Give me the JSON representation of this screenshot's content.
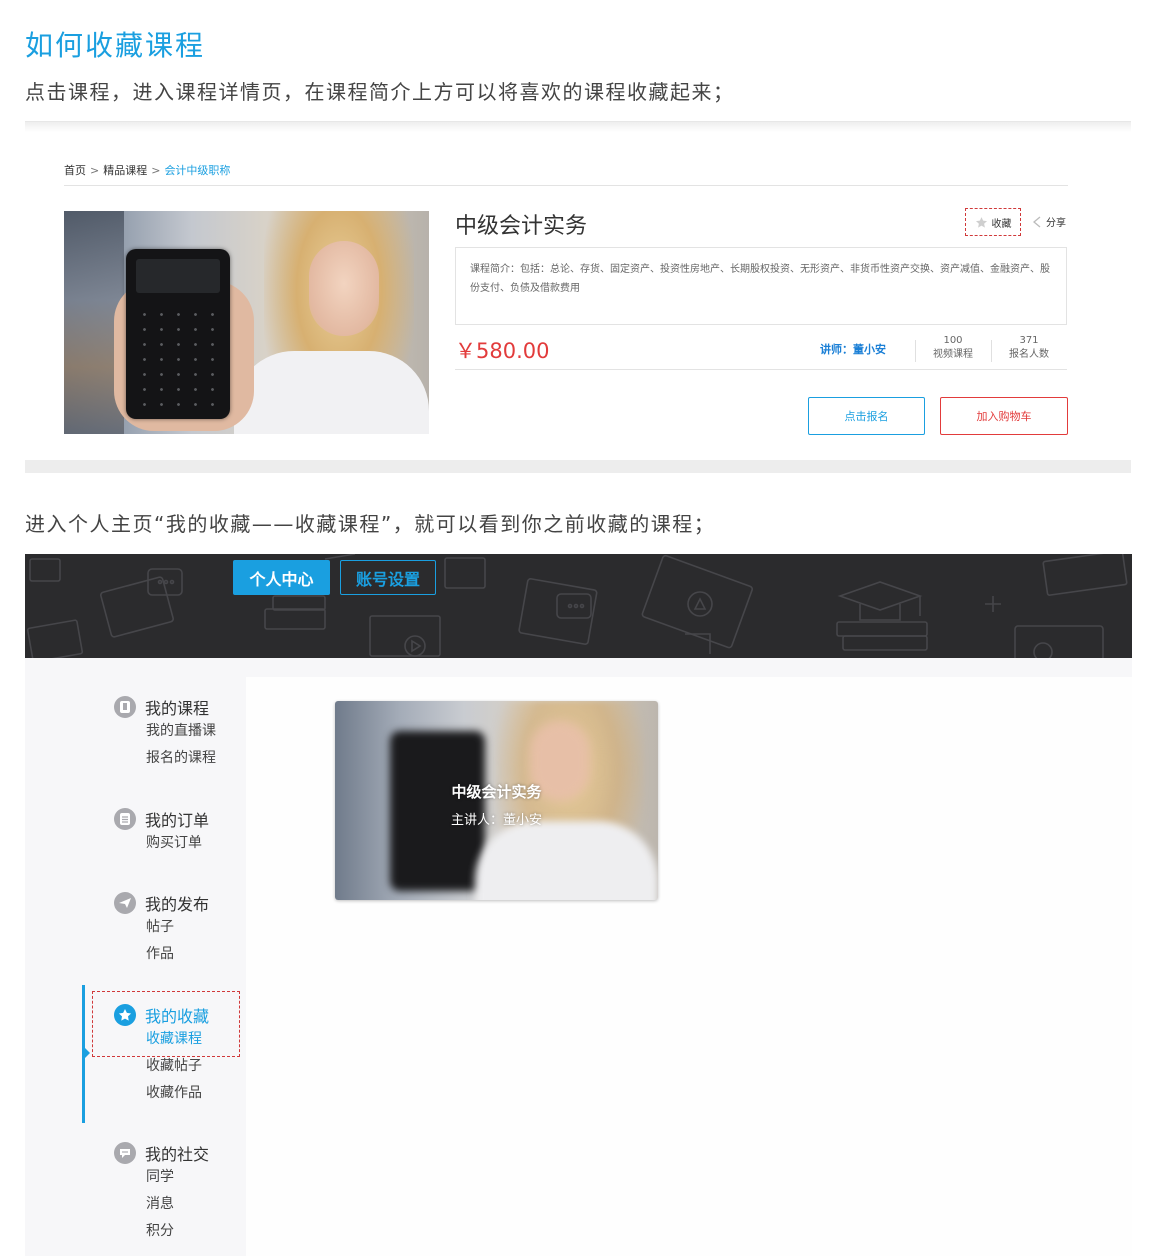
{
  "section1": {
    "title": "如何收藏课程",
    "description": "点击课程，进入课程详情页，在课程简介上方可以将喜欢的课程收藏起来；"
  },
  "course_detail": {
    "breadcrumb": [
      "首页",
      "精品课程",
      "会计中级职称"
    ],
    "breadcrumb_separator": ">",
    "course_title": "中级会计实务",
    "favorite_label": "收藏",
    "share_label": "分享",
    "intro": "课程简介：包括：总论、存货、固定资产、投资性房地产、长期股权投资、无形资产、非货币性资产交换、资产减值、金融资产、股份支付、负债及借款费用",
    "price": "￥580.00",
    "teacher": "讲师：董小安",
    "stats": [
      {
        "value": "100",
        "label": "视频课程"
      },
      {
        "value": "371",
        "label": "报名人数"
      }
    ],
    "enroll_button": "点击报名",
    "cart_button": "加入购物车"
  },
  "section2": {
    "description": "进入个人主页“我的收藏——收藏课程”，就可以看到你之前收藏的课程；"
  },
  "profile": {
    "tabs": {
      "personal": "个人中心",
      "account": "账号设置"
    },
    "menu": {
      "courses": {
        "title": "我的课程",
        "items": [
          "我的直播课",
          "报名的课程"
        ]
      },
      "orders": {
        "title": "我的订单",
        "items": [
          "购买订单"
        ]
      },
      "posts": {
        "title": "我的发布",
        "items": [
          "帖子",
          "作品"
        ]
      },
      "favorites": {
        "title": "我的收藏",
        "items": [
          "收藏课程",
          "收藏帖子",
          "收藏作品"
        ]
      },
      "social": {
        "title": "我的社交",
        "items": [
          "同学",
          "消息",
          "积分"
        ]
      }
    },
    "card": {
      "title": "中级会计实务",
      "teacher": "主讲人：董小安"
    }
  },
  "colors": {
    "accent": "#1a9fe0",
    "price": "#e23b3b",
    "highlight_dash": "#d0393a",
    "banner": "#2b2b2d",
    "menu_icon": "#a9a9ae"
  }
}
